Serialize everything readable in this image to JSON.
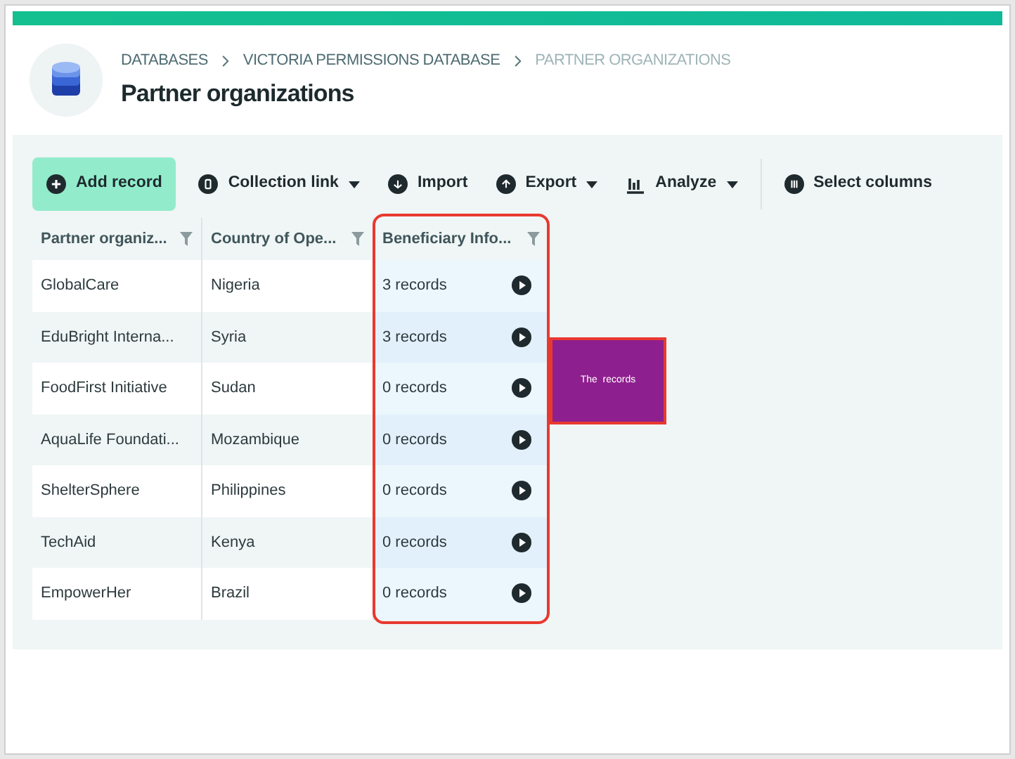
{
  "breadcrumb": [
    {
      "label": "DATABASES",
      "current": false
    },
    {
      "label": "VICTORIA PERMISSIONS DATABASE",
      "current": false
    },
    {
      "label": "PARTNER ORGANIZATIONS",
      "current": true
    }
  ],
  "title": "Partner organizations",
  "toolbar": [
    {
      "label": "Add record",
      "kind": "primary",
      "dropdown": false
    },
    {
      "label": "Collection link",
      "kind": "plain",
      "dropdown": true
    },
    {
      "label": "Import",
      "kind": "plain",
      "dropdown": false
    },
    {
      "label": "Export",
      "kind": "plain",
      "dropdown": true
    },
    {
      "label": "Analyze",
      "kind": "plain",
      "dropdown": true
    },
    {
      "label": "Select columns",
      "kind": "separated",
      "dropdown": false
    }
  ],
  "table": {
    "columns": [
      {
        "label": "Partner organiz...",
        "highlighted": false
      },
      {
        "label": "Country of Ope...",
        "highlighted": false
      },
      {
        "label": "Beneficiary Info...",
        "highlighted": true
      }
    ],
    "rows": [
      [
        "GlobalCare",
        "Nigeria",
        "3 records"
      ],
      [
        "EduBright Interna...",
        "Syria",
        "3 records"
      ],
      [
        "FoodFirst Initiative",
        "Sudan",
        "0 records"
      ],
      [
        "AquaLife Foundati...",
        "Mozambique",
        "0 records"
      ],
      [
        "ShelterSphere",
        "Philippines",
        "0 records"
      ],
      [
        "TechAid",
        "Kenya",
        "0 records"
      ],
      [
        "EmpowerHer",
        "Brazil",
        "0 records"
      ]
    ]
  },
  "callout": {
    "text": "The  records",
    "color": "#8e1f8e"
  }
}
